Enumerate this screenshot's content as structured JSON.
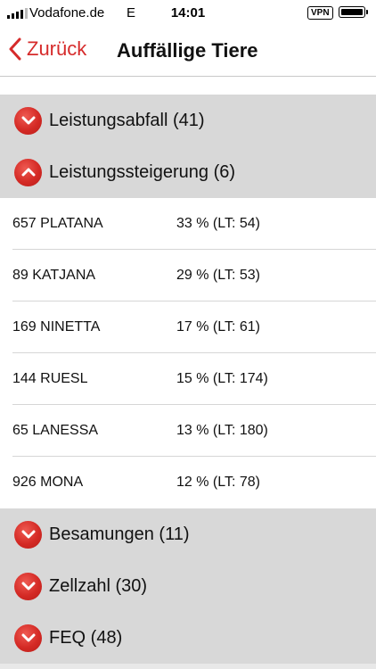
{
  "status_bar": {
    "carrier": "Vodafone.de",
    "network": "E",
    "time": "14:01",
    "vpn": "VPN"
  },
  "nav": {
    "back_label": "Zurück",
    "title": "Auffällige Tiere"
  },
  "sections": [
    {
      "label": "Leistungsabfall (41)",
      "expanded": false
    },
    {
      "label": "Leistungssteigerung (6)",
      "expanded": true
    },
    {
      "label": "Besamungen (11)",
      "expanded": false
    },
    {
      "label": "Zellzahl (30)",
      "expanded": false
    },
    {
      "label": "FEQ (48)",
      "expanded": false
    }
  ],
  "rows": [
    {
      "name": "657 PLATANA",
      "value": "33 % (LT: 54)"
    },
    {
      "name": "89 KATJANA",
      "value": "29 % (LT: 53)"
    },
    {
      "name": "169 NINETTA",
      "value": "17 % (LT: 61)"
    },
    {
      "name": "144 RUESL",
      "value": "15 % (LT: 174)"
    },
    {
      "name": "65 LANESSA",
      "value": "13 % (LT: 180)"
    },
    {
      "name": "926 MONA",
      "value": "12 % (LT: 78)"
    }
  ],
  "colors": {
    "accent": "#d62b2b",
    "section_bg": "#d8d8d8"
  }
}
